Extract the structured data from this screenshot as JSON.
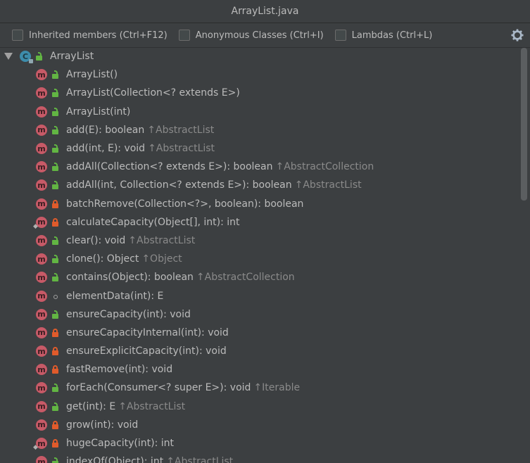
{
  "window": {
    "title": "ArrayList.java"
  },
  "filters": [
    {
      "label": "Inherited members (Ctrl+F12)"
    },
    {
      "label": "Anonymous Classes (Ctrl+I)"
    },
    {
      "label": "Lambdas (Ctrl+L)"
    }
  ],
  "tree": {
    "root": {
      "icon_letter": "C",
      "label": "ArrayList"
    },
    "items": [
      {
        "signature": "ArrayList()",
        "visibility": "public",
        "inherited": ""
      },
      {
        "signature": "ArrayList(Collection<? extends E>)",
        "visibility": "public",
        "inherited": ""
      },
      {
        "signature": "ArrayList(int)",
        "visibility": "public",
        "inherited": ""
      },
      {
        "signature": "add(E): boolean",
        "visibility": "public",
        "inherited": "↑AbstractList"
      },
      {
        "signature": "add(int, E): void",
        "visibility": "public",
        "inherited": "↑AbstractList"
      },
      {
        "signature": "addAll(Collection<? extends E>): boolean",
        "visibility": "public",
        "inherited": "↑AbstractCollection"
      },
      {
        "signature": "addAll(int, Collection<? extends E>): boolean",
        "visibility": "public",
        "inherited": "↑AbstractList"
      },
      {
        "signature": "batchRemove(Collection<?>, boolean): boolean",
        "visibility": "private",
        "inherited": ""
      },
      {
        "signature": "calculateCapacity(Object[], int): int",
        "visibility": "private",
        "inherited": "",
        "static": true
      },
      {
        "signature": "clear(): void",
        "visibility": "public",
        "inherited": "↑AbstractList"
      },
      {
        "signature": "clone(): Object",
        "visibility": "public",
        "inherited": "↑Object"
      },
      {
        "signature": "contains(Object): boolean",
        "visibility": "public",
        "inherited": "↑AbstractCollection"
      },
      {
        "signature": "elementData(int): E",
        "visibility": "package",
        "inherited": ""
      },
      {
        "signature": "ensureCapacity(int): void",
        "visibility": "public",
        "inherited": ""
      },
      {
        "signature": "ensureCapacityInternal(int): void",
        "visibility": "private",
        "inherited": ""
      },
      {
        "signature": "ensureExplicitCapacity(int): void",
        "visibility": "private",
        "inherited": ""
      },
      {
        "signature": "fastRemove(int): void",
        "visibility": "private",
        "inherited": ""
      },
      {
        "signature": "forEach(Consumer<? super E>): void",
        "visibility": "public",
        "inherited": "↑Iterable"
      },
      {
        "signature": "get(int): E",
        "visibility": "public",
        "inherited": "↑AbstractList"
      },
      {
        "signature": "grow(int): void",
        "visibility": "private",
        "inherited": ""
      },
      {
        "signature": "hugeCapacity(int): int",
        "visibility": "private",
        "inherited": "",
        "static": true
      },
      {
        "signature": "indexOf(Object): int",
        "visibility": "public",
        "inherited": "↑AbstractList"
      }
    ]
  },
  "colors": {
    "background": "#3c3f41",
    "method_icon": "#c75a67",
    "class_icon": "#3d8cab",
    "public": "#62b543",
    "private": "#e05b2b",
    "inherited_text": "#8a8a8a"
  }
}
